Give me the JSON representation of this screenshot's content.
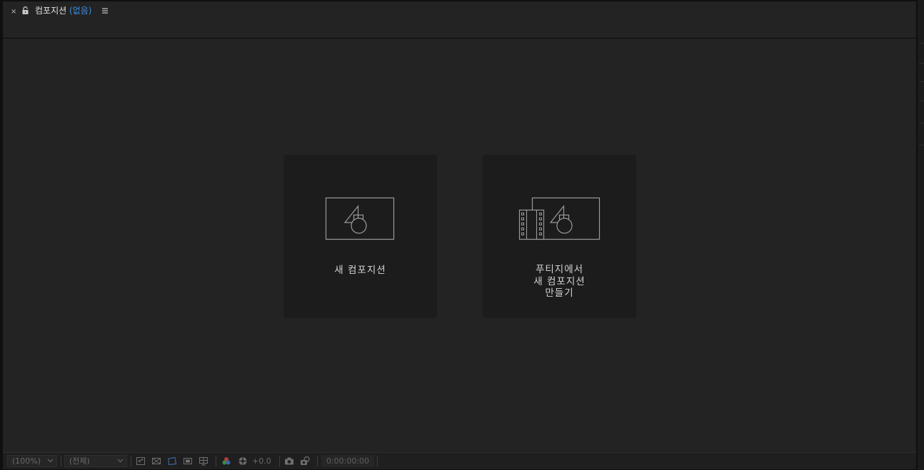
{
  "panel": {
    "close_glyph": "×",
    "title": "컴포지션",
    "title_status": "(없음)",
    "lock_icon": "lock-icon",
    "menu_icon": "hamburger-menu-icon"
  },
  "cards": {
    "new_composition": {
      "label": "새 컴포지션",
      "icon": "composition-icon"
    },
    "from_footage": {
      "label_lines": [
        "푸티지에서",
        "새 컴포지션",
        "만들기"
      ],
      "icon": "footage-composition-icon"
    }
  },
  "toolbar": {
    "zoom": "(100%)",
    "resolution": "(전체)",
    "exposure": "+0.0",
    "timecode": "0:00:00:00",
    "icons": [
      "snapshot-region-icon",
      "transparency-grid-icon",
      "mask-outline-icon",
      "safe-area-icon",
      "grid-guides-icon",
      "color-channels-icon",
      "exposure-reset-icon",
      "camera-snapshot-icon",
      "show-snapshot-icon"
    ]
  },
  "colors": {
    "accent_blue": "#3d8dde",
    "panel_bg": "#232323",
    "card_bg": "#1c1c1c",
    "icon_stroke": "#9a9a9a"
  }
}
